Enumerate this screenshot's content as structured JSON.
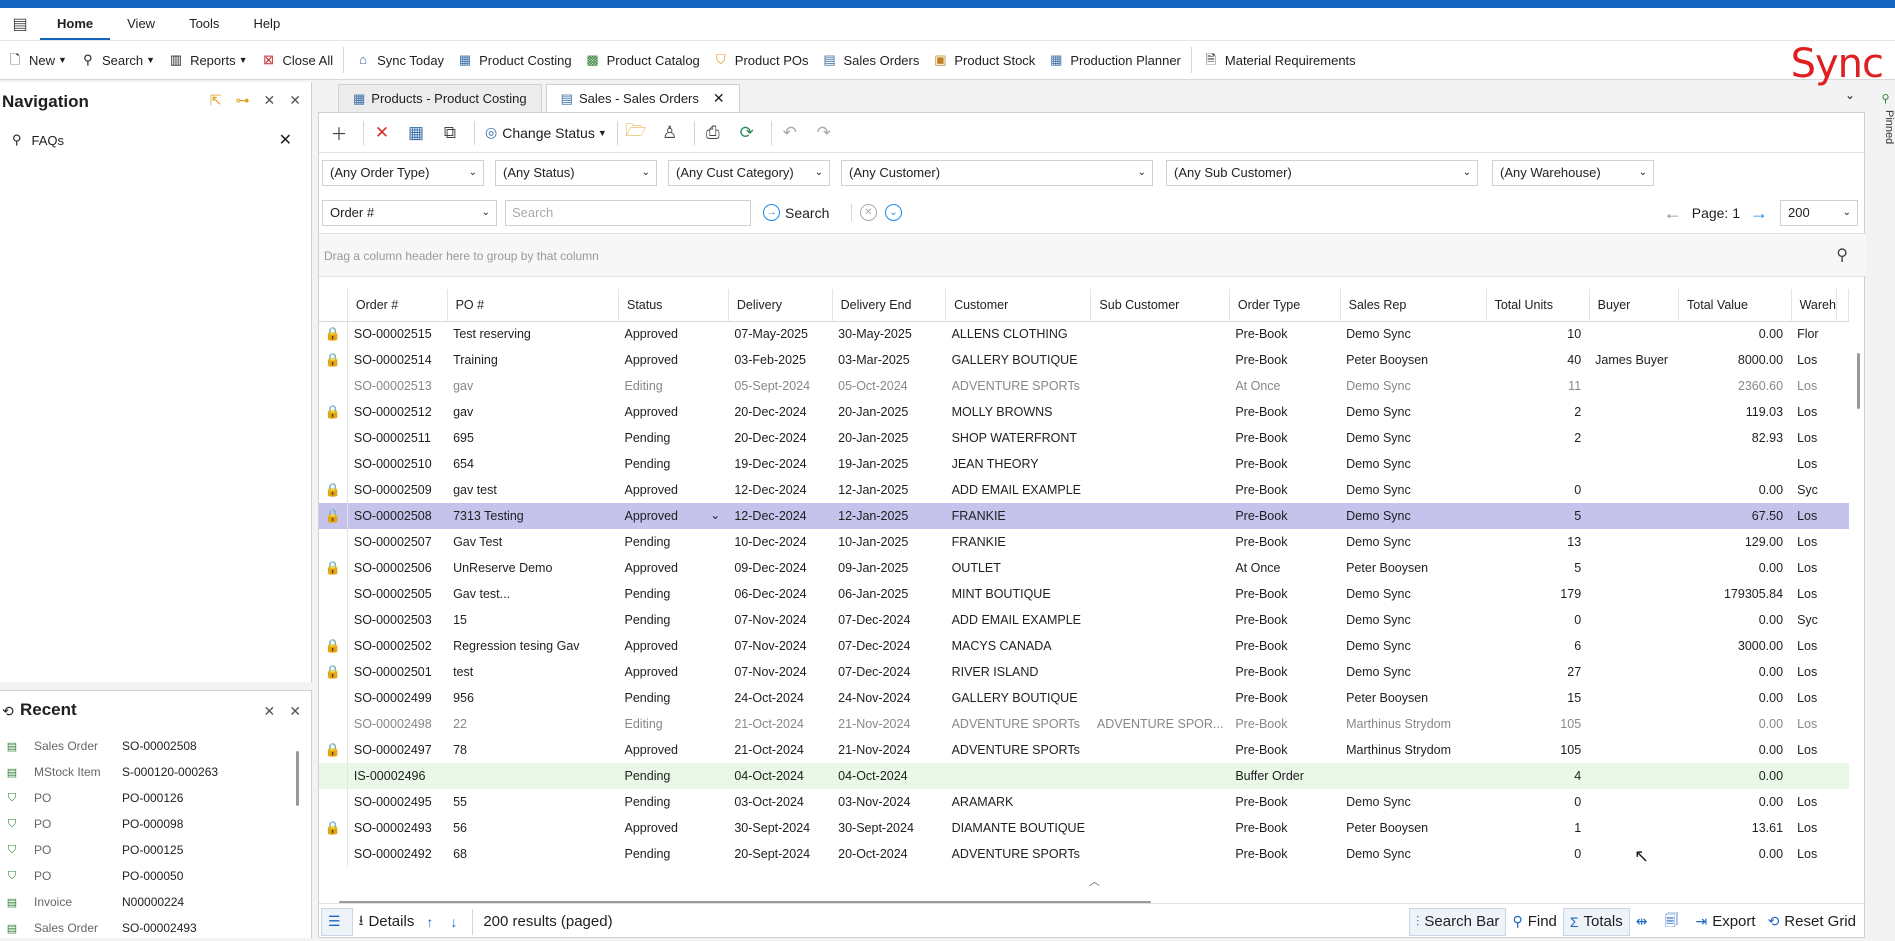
{
  "menubar": {
    "items": [
      "Home",
      "View",
      "Tools",
      "Help"
    ],
    "active": "Home"
  },
  "toolbar": {
    "new": "New",
    "search": "Search",
    "reports": "Reports",
    "close_all": "Close All",
    "sync_today": "Sync Today",
    "product_costing": "Product Costing",
    "product_catalog": "Product Catalog",
    "product_pos": "Product POs",
    "sales_orders": "Sales Orders",
    "product_stock": "Product Stock",
    "production_planner": "Production Planner",
    "material_requirements": "Material Requirements",
    "logo": "Sync"
  },
  "navigation": {
    "title": "Navigation",
    "faq": "FAQs"
  },
  "recent": {
    "title": "Recent",
    "items": [
      {
        "type": "Sales Order",
        "value": "SO-00002508"
      },
      {
        "type": "MStock Item",
        "value": "S-000120-000263"
      },
      {
        "type": "PO",
        "value": "PO-000126"
      },
      {
        "type": "PO",
        "value": "PO-000098"
      },
      {
        "type": "PO",
        "value": "PO-000125"
      },
      {
        "type": "PO",
        "value": "PO-000050"
      },
      {
        "type": "Invoice",
        "value": "N00000224"
      },
      {
        "type": "Sales Order",
        "value": "SO-00002493"
      }
    ]
  },
  "tabs": [
    {
      "label": "Products - Product Costing",
      "active": false
    },
    {
      "label": "Sales - Sales Orders",
      "active": true
    }
  ],
  "grid_toolbar": {
    "change_status": "Change Status"
  },
  "filters": {
    "order_type": "(Any Order Type)",
    "status": "(Any Status)",
    "cust_category": "(Any Cust Category)",
    "customer": "(Any Customer)",
    "sub_customer": "(Any Sub Customer)",
    "warehouse": "(Any Warehouse)"
  },
  "search": {
    "field": "Order #",
    "placeholder": "Search",
    "button": "Search",
    "page_label": "Page: 1",
    "page_size": "200"
  },
  "group_hint": "Drag a column header here to group by that column",
  "pinned": "Pinned",
  "columns": [
    "Order #",
    "PO #",
    "Status",
    "Delivery",
    "Delivery End",
    "Customer",
    "Sub Customer",
    "Order Type",
    "Sales Rep",
    "Total Units",
    "Buyer",
    "Total Value",
    "Wareh"
  ],
  "rows": [
    {
      "lock": true,
      "order": "SO-00002515",
      "po": "Test reserving",
      "status": "Approved",
      "delivery": "07-May-2025",
      "delivery_end": "30-May-2025",
      "customer": "ALLENS CLOTHING",
      "sub_customer": "",
      "order_type": "Pre-Book",
      "sales_rep": "Demo Sync",
      "units": "10",
      "buyer": "",
      "value": "0.00",
      "warehouse": "Flor",
      "state": ""
    },
    {
      "lock": true,
      "order": "SO-00002514",
      "po": "Training",
      "status": "Approved",
      "delivery": "03-Feb-2025",
      "delivery_end": "03-Mar-2025",
      "customer": "GALLERY BOUTIQUE",
      "sub_customer": "",
      "order_type": "Pre-Book",
      "sales_rep": "Peter Booysen",
      "units": "40",
      "buyer": "James Buyer",
      "value": "8000.00",
      "warehouse": "Los",
      "state": ""
    },
    {
      "lock": false,
      "order": "SO-00002513",
      "po": "gav",
      "status": "Editing",
      "delivery": "05-Sept-2024",
      "delivery_end": "05-Oct-2024",
      "customer": "ADVENTURE SPORTs",
      "sub_customer": "",
      "order_type": "At Once",
      "sales_rep": "Demo Sync",
      "units": "11",
      "buyer": "",
      "value": "2360.60",
      "warehouse": "Los",
      "state": "editing"
    },
    {
      "lock": true,
      "order": "SO-00002512",
      "po": "gav",
      "status": "Approved",
      "delivery": "20-Dec-2024",
      "delivery_end": "20-Jan-2025",
      "customer": "MOLLY BROWNS",
      "sub_customer": "",
      "order_type": "Pre-Book",
      "sales_rep": "Demo Sync",
      "units": "2",
      "buyer": "",
      "value": "119.03",
      "warehouse": "Los",
      "state": ""
    },
    {
      "lock": false,
      "order": "SO-00002511",
      "po": "695",
      "status": "Pending",
      "delivery": "20-Dec-2024",
      "delivery_end": "20-Jan-2025",
      "customer": "SHOP WATERFRONT",
      "sub_customer": "",
      "order_type": "Pre-Book",
      "sales_rep": "Demo Sync",
      "units": "2",
      "buyer": "",
      "value": "82.93",
      "warehouse": "Los",
      "state": ""
    },
    {
      "lock": false,
      "order": "SO-00002510",
      "po": "654",
      "status": "Pending",
      "delivery": "19-Dec-2024",
      "delivery_end": "19-Jan-2025",
      "customer": "JEAN THEORY",
      "sub_customer": "",
      "order_type": "Pre-Book",
      "sales_rep": "Demo Sync",
      "units": "",
      "buyer": "",
      "value": "",
      "warehouse": "Los",
      "state": ""
    },
    {
      "lock": true,
      "order": "SO-00002509",
      "po": "gav test",
      "status": "Approved",
      "delivery": "12-Dec-2024",
      "delivery_end": "12-Jan-2025",
      "customer": "ADD EMAIL EXAMPLE",
      "sub_customer": "",
      "order_type": "Pre-Book",
      "sales_rep": "Demo Sync",
      "units": "0",
      "buyer": "",
      "value": "0.00",
      "warehouse": "Syc",
      "state": ""
    },
    {
      "lock": true,
      "order": "SO-00002508",
      "po": "7313 Testing",
      "status": "Approved",
      "delivery": "12-Dec-2024",
      "delivery_end": "12-Jan-2025",
      "customer": "FRANKIE",
      "sub_customer": "",
      "order_type": "Pre-Book",
      "sales_rep": "Demo Sync",
      "units": "5",
      "buyer": "",
      "value": "67.50",
      "warehouse": "Los",
      "state": "selected"
    },
    {
      "lock": false,
      "order": "SO-00002507",
      "po": " Gav Test",
      "status": "Pending",
      "delivery": "10-Dec-2024",
      "delivery_end": "10-Jan-2025",
      "customer": "FRANKIE",
      "sub_customer": "",
      "order_type": "Pre-Book",
      "sales_rep": "Demo Sync",
      "units": "13",
      "buyer": "",
      "value": "129.00",
      "warehouse": "Los",
      "state": ""
    },
    {
      "lock": true,
      "order": "SO-00002506",
      "po": "UnReserve Demo",
      "status": "Approved",
      "delivery": "09-Dec-2024",
      "delivery_end": "09-Jan-2025",
      "customer": "OUTLET",
      "sub_customer": "",
      "order_type": "At Once",
      "sales_rep": "Peter Booysen",
      "units": "5",
      "buyer": "",
      "value": "0.00",
      "warehouse": "Los",
      "state": ""
    },
    {
      "lock": false,
      "order": "SO-00002505",
      "po": "Gav test...",
      "status": "Pending",
      "delivery": "06-Dec-2024",
      "delivery_end": "06-Jan-2025",
      "customer": "MINT BOUTIQUE",
      "sub_customer": "",
      "order_type": "Pre-Book",
      "sales_rep": "Demo Sync",
      "units": "179",
      "buyer": "",
      "value": "179305.84",
      "warehouse": "Los",
      "state": ""
    },
    {
      "lock": false,
      "order": "SO-00002503",
      "po": "15",
      "status": "Pending",
      "delivery": "07-Nov-2024",
      "delivery_end": "07-Dec-2024",
      "customer": "ADD EMAIL EXAMPLE",
      "sub_customer": "",
      "order_type": "Pre-Book",
      "sales_rep": "Demo Sync",
      "units": "0",
      "buyer": "",
      "value": "0.00",
      "warehouse": "Syc",
      "state": ""
    },
    {
      "lock": true,
      "order": "SO-00002502",
      "po": "Regression tesing Gav",
      "status": "Approved",
      "delivery": "07-Nov-2024",
      "delivery_end": "07-Dec-2024",
      "customer": "MACYS CANADA",
      "sub_customer": "",
      "order_type": "Pre-Book",
      "sales_rep": "Demo Sync",
      "units": "6",
      "buyer": "",
      "value": "3000.00",
      "warehouse": "Los",
      "state": ""
    },
    {
      "lock": true,
      "order": "SO-00002501",
      "po": "test",
      "status": "Approved",
      "delivery": "07-Nov-2024",
      "delivery_end": "07-Dec-2024",
      "customer": "RIVER ISLAND",
      "sub_customer": "",
      "order_type": "Pre-Book",
      "sales_rep": "Demo Sync",
      "units": "27",
      "buyer": "",
      "value": "0.00",
      "warehouse": "Los",
      "state": ""
    },
    {
      "lock": false,
      "order": "SO-00002499",
      "po": "956",
      "status": "Pending",
      "delivery": "24-Oct-2024",
      "delivery_end": "24-Nov-2024",
      "customer": "GALLERY BOUTIQUE",
      "sub_customer": "",
      "order_type": "Pre-Book",
      "sales_rep": "Peter Booysen",
      "units": "15",
      "buyer": "",
      "value": "0.00",
      "warehouse": "Los",
      "state": ""
    },
    {
      "lock": false,
      "order": "SO-00002498",
      "po": "22",
      "status": "Editing",
      "delivery": "21-Oct-2024",
      "delivery_end": "21-Nov-2024",
      "customer": "ADVENTURE SPORTs",
      "sub_customer": "ADVENTURE SPOR...",
      "order_type": "Pre-Book",
      "sales_rep": "Marthinus Strydom",
      "units": "105",
      "buyer": "",
      "value": "0.00",
      "warehouse": "Los",
      "state": "editing"
    },
    {
      "lock": true,
      "order": "SO-00002497",
      "po": "78",
      "status": "Approved",
      "delivery": "21-Oct-2024",
      "delivery_end": "21-Nov-2024",
      "customer": "ADVENTURE SPORTs",
      "sub_customer": "",
      "order_type": "Pre-Book",
      "sales_rep": "Marthinus Strydom",
      "units": "105",
      "buyer": "",
      "value": "0.00",
      "warehouse": "Los",
      "state": ""
    },
    {
      "lock": false,
      "order": "IS-00002496",
      "po": "",
      "status": "Pending",
      "delivery": "04-Oct-2024",
      "delivery_end": "04-Oct-2024",
      "customer": "",
      "sub_customer": "",
      "order_type": "Buffer Order",
      "sales_rep": "",
      "units": "4",
      "buyer": "",
      "value": "0.00",
      "warehouse": "",
      "state": "buffer"
    },
    {
      "lock": false,
      "order": "SO-00002495",
      "po": "55",
      "status": "Pending",
      "delivery": "03-Oct-2024",
      "delivery_end": "03-Nov-2024",
      "customer": "ARAMARK",
      "sub_customer": "",
      "order_type": "Pre-Book",
      "sales_rep": "Demo Sync",
      "units": "0",
      "buyer": "",
      "value": "0.00",
      "warehouse": "Los",
      "state": ""
    },
    {
      "lock": true,
      "order": "SO-00002493",
      "po": "56",
      "status": "Approved",
      "delivery": "30-Sept-2024",
      "delivery_end": "30-Sept-2024",
      "customer": "DIAMANTE BOUTIQUE",
      "sub_customer": "",
      "order_type": "Pre-Book",
      "sales_rep": "Peter Booysen",
      "units": "1",
      "buyer": "",
      "value": "13.61",
      "warehouse": "Los",
      "state": ""
    },
    {
      "lock": false,
      "order": "SO-00002492",
      "po": "68",
      "status": "Pending",
      "delivery": "20-Sept-2024",
      "delivery_end": "20-Oct-2024",
      "customer": "ADVENTURE SPORTs",
      "sub_customer": "",
      "order_type": "Pre-Book",
      "sales_rep": "Demo Sync",
      "units": "0",
      "buyer": "",
      "value": "0.00",
      "warehouse": "Los",
      "state": ""
    }
  ],
  "bottom": {
    "details": "Details",
    "results": "200 results (paged)",
    "search_bar": "Search Bar",
    "find": "Find",
    "totals": "Totals",
    "export": "Export",
    "reset_grid": "Reset Grid"
  }
}
